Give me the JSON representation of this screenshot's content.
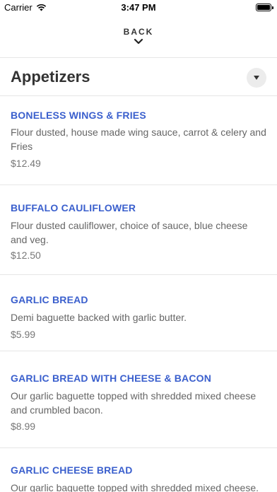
{
  "status_bar": {
    "carrier": "Carrier",
    "time": "3:47 PM",
    "battery_level": 1.0
  },
  "nav": {
    "back_label": "BACK"
  },
  "section": {
    "title": "Appetizers"
  },
  "items": [
    {
      "name": "BONELESS WINGS & FRIES",
      "description": "Flour dusted, house made wing sauce, carrot & celery and Fries",
      "price": "$12.49"
    },
    {
      "name": "BUFFALO CAULIFLOWER",
      "description": "Flour dusted cauliflower, choice of sauce, blue cheese and veg.",
      "price": "$12.50"
    },
    {
      "name": "GARLIC BREAD",
      "description": "Demi baguette backed with garlic butter.",
      "price": "$5.99"
    },
    {
      "name": "GARLIC BREAD WITH CHEESE & BACON",
      "description": "Our garlic baguette topped with shredded mixed cheese and crumbled bacon.",
      "price": "$8.99"
    },
    {
      "name": "GARLIC CHEESE BREAD",
      "description": "Our garlic baguette topped with shredded mixed cheese.",
      "price": ""
    }
  ]
}
